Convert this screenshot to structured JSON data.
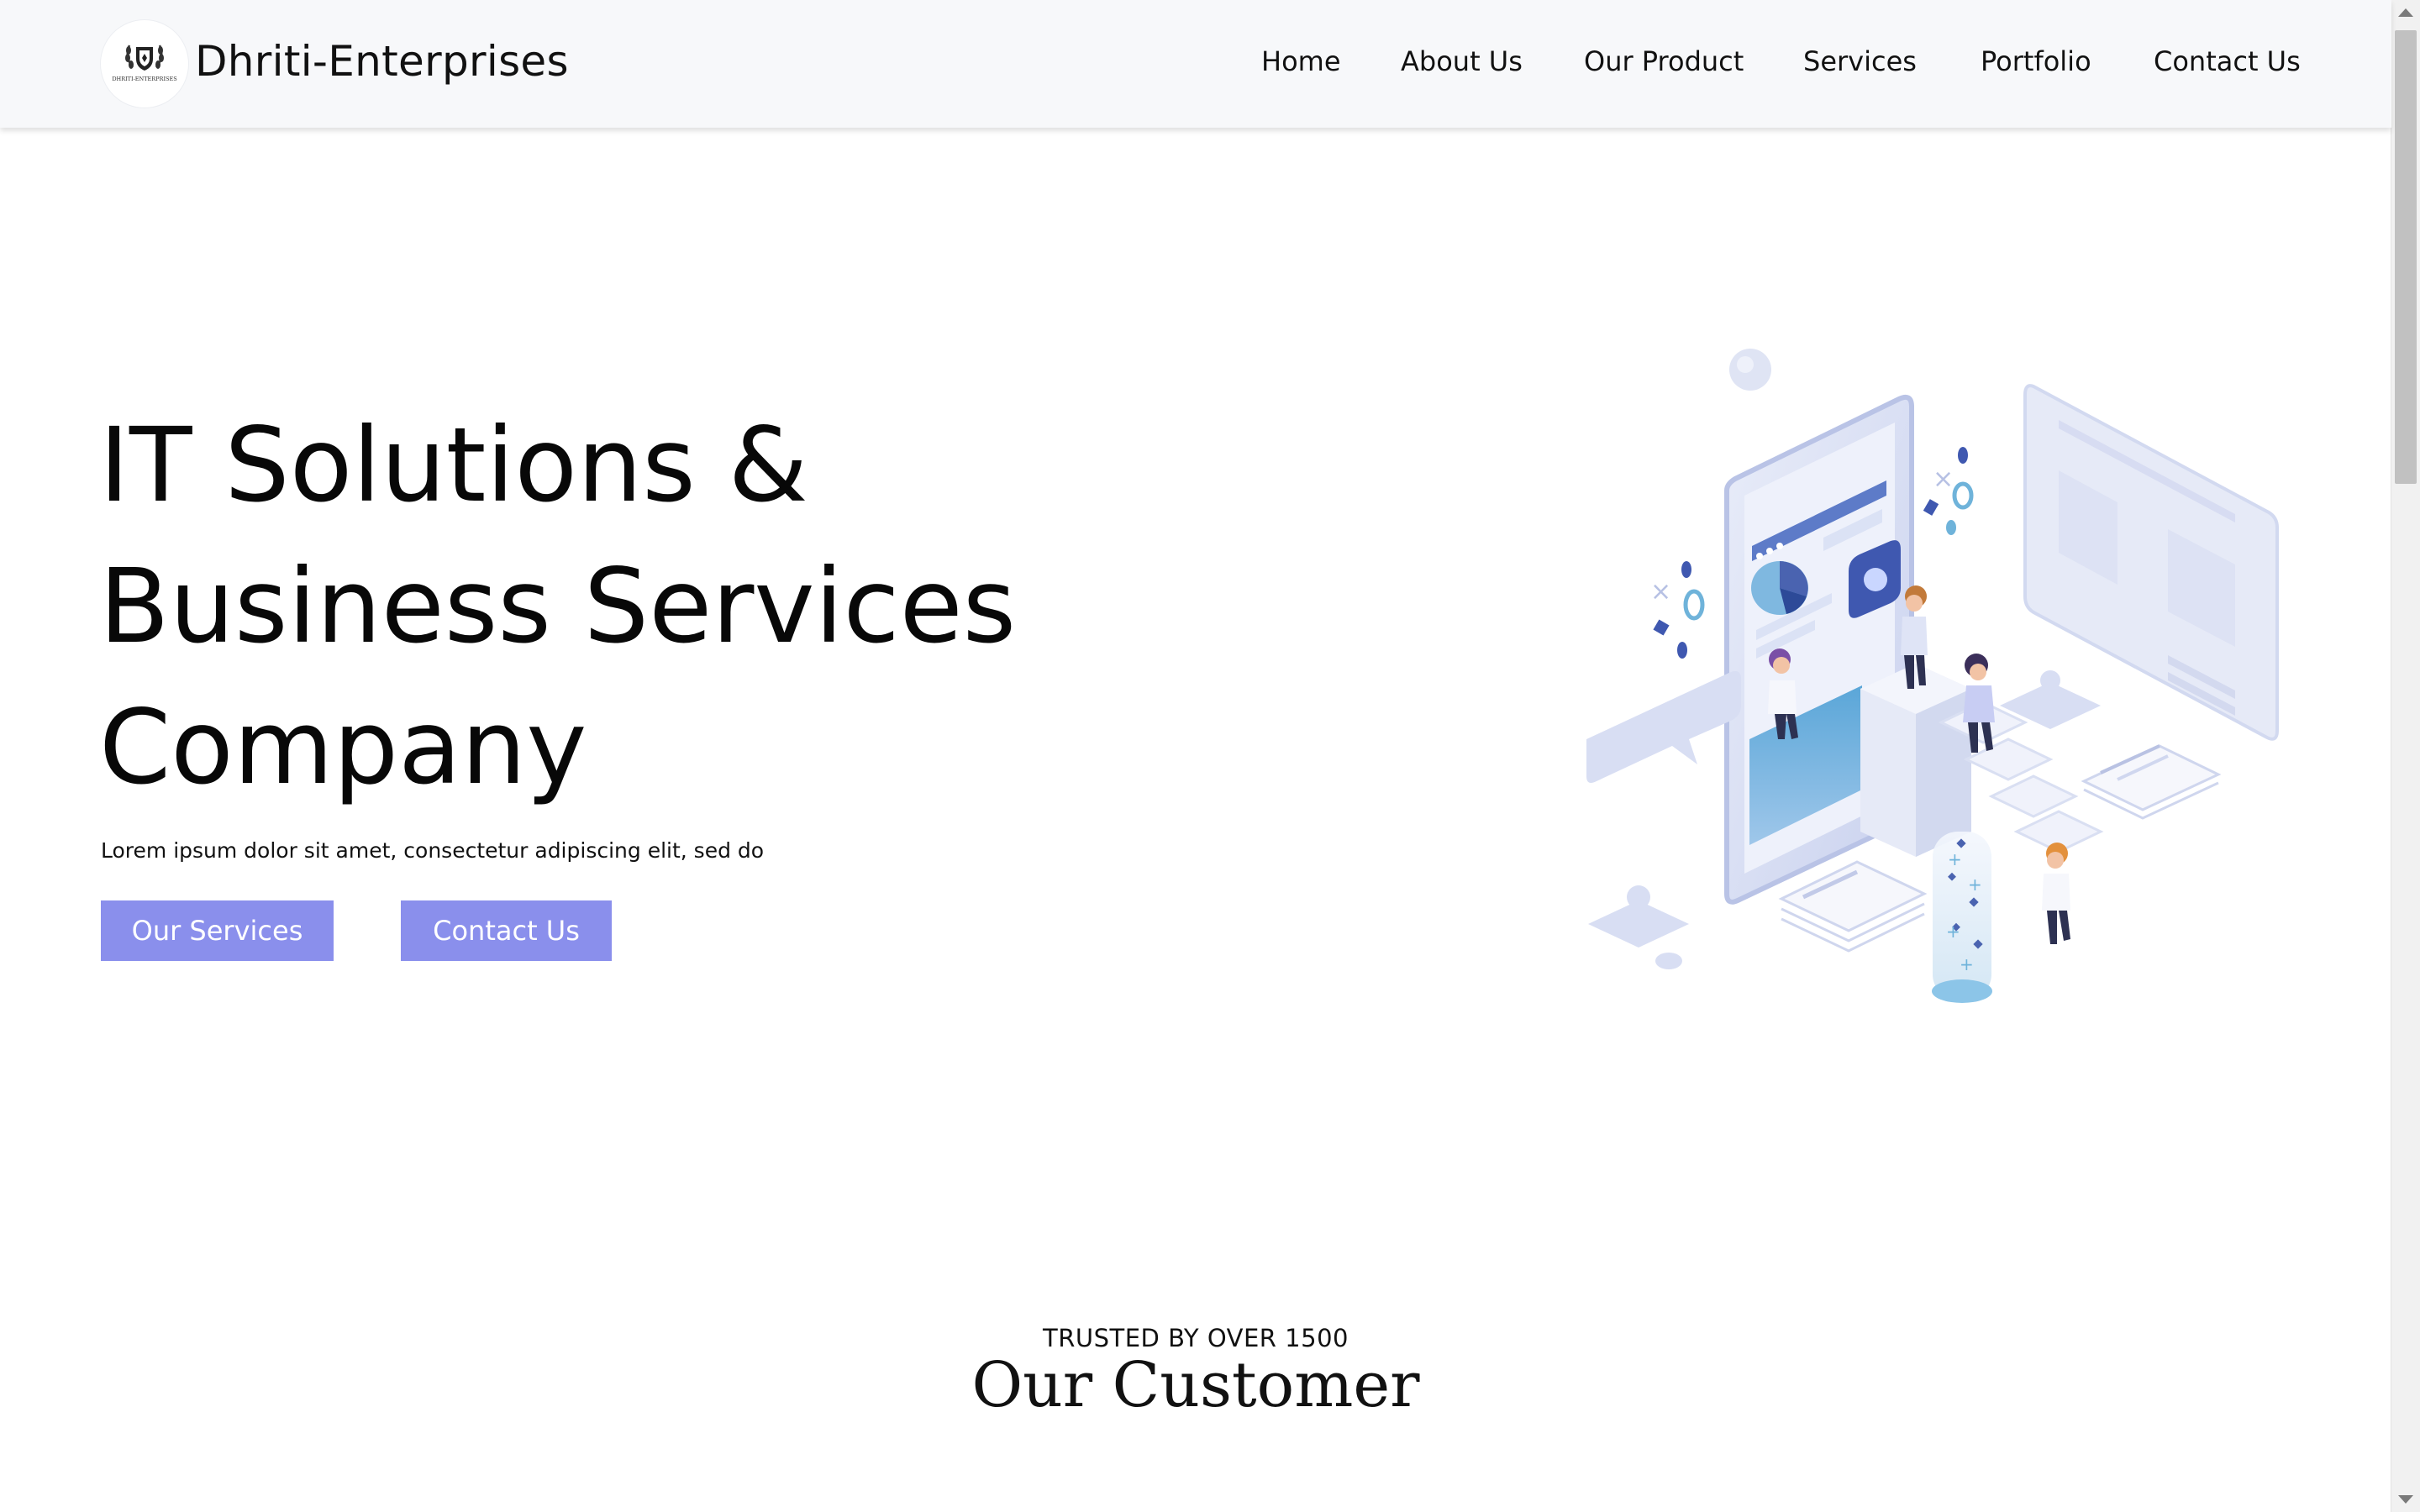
{
  "header": {
    "brand": "Dhriti-Enterprises",
    "logo_text": "DHRITI-ENTERPRISES",
    "nav": [
      "Home",
      "About Us",
      "Our Product",
      "Services",
      "Portfolio",
      "Contact Us"
    ]
  },
  "hero": {
    "title_lines": [
      "IT Solutions &",
      "Business Services",
      "Company"
    ],
    "subtitle": "Lorem ipsum dolor sit amet, consectetur adipiscing elit, sed do",
    "primary_button": "Our Services",
    "secondary_button": "Contact Us"
  },
  "customers": {
    "kicker": "TRUSTED BY OVER 1500",
    "title": "Our Customer"
  },
  "colors": {
    "header_bg": "#f7f8fa",
    "button_bg": "#8a8fec",
    "accent_blue": "#4a63b0",
    "illustration_light": "#dfe4f6"
  },
  "icons": {
    "logo": "laurel-shield-logo-icon",
    "illustration": "isometric-phone-team-illustration"
  }
}
